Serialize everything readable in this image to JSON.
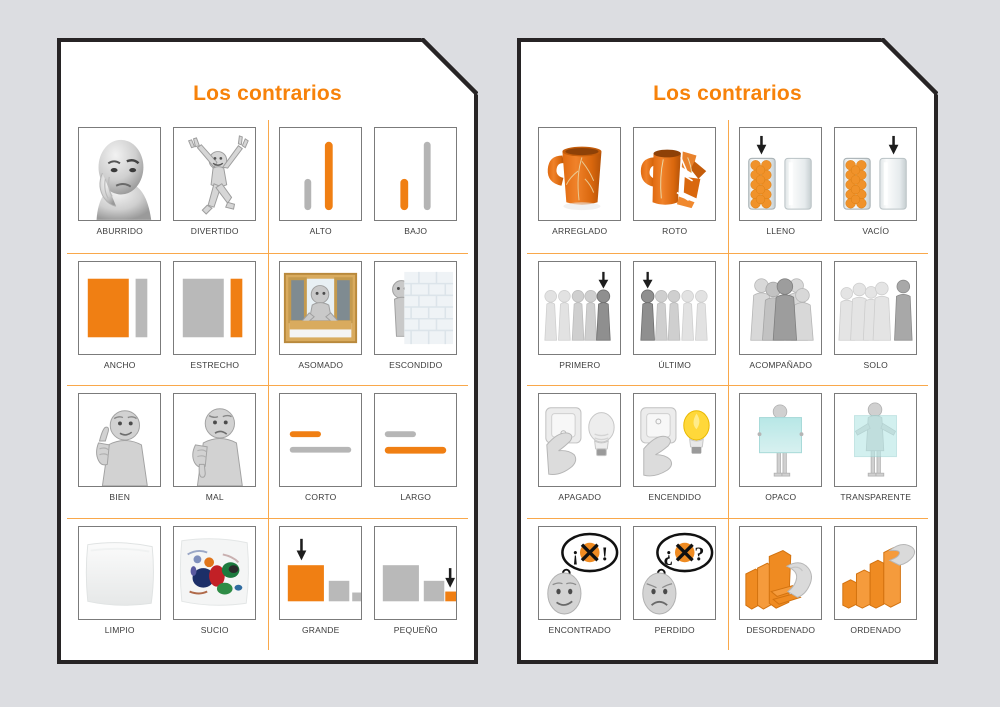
{
  "background_color": "#dcdde1",
  "accent_color": "#F7820A",
  "divider_color": "#F9A84B",
  "page_border_color": "#272425",
  "caption_color": "#3b3b3b",
  "pages": [
    {
      "title": "Los contrarios",
      "rows": [
        {
          "left": [
            {
              "label": "ABURRIDO",
              "icon": "bored-face-icon"
            },
            {
              "label": "DIVERTIDO",
              "icon": "jumping-figure-icon"
            }
          ],
          "right": [
            {
              "label": "ALTO",
              "icon": "tall-bar-icon"
            },
            {
              "label": "BAJO",
              "icon": "short-bar-icon"
            }
          ]
        },
        {
          "left": [
            {
              "label": "ANCHO",
              "icon": "wide-rectangle-icon"
            },
            {
              "label": "ESTRECHO",
              "icon": "narrow-rectangle-icon"
            }
          ],
          "right": [
            {
              "label": "ASOMADO",
              "icon": "figure-at-window-icon"
            },
            {
              "label": "ESCONDIDO",
              "icon": "figure-behind-wall-icon"
            }
          ]
        },
        {
          "left": [
            {
              "label": "BIEN",
              "icon": "thumbs-up-icon"
            },
            {
              "label": "MAL",
              "icon": "thumbs-down-icon"
            }
          ],
          "right": [
            {
              "label": "CORTO",
              "icon": "short-line-icon"
            },
            {
              "label": "LARGO",
              "icon": "long-line-icon"
            }
          ]
        },
        {
          "left": [
            {
              "label": "LIMPIO",
              "icon": "clean-cloth-icon"
            },
            {
              "label": "SUCIO",
              "icon": "dirty-cloth-icon"
            }
          ],
          "right": [
            {
              "label": "GRANDE",
              "icon": "big-square-icon"
            },
            {
              "label": "PEQUEÑO",
              "icon": "small-square-icon"
            }
          ]
        }
      ]
    },
    {
      "title": "Los contrarios",
      "rows": [
        {
          "left": [
            {
              "label": "ARREGLADO",
              "icon": "whole-mug-icon"
            },
            {
              "label": "ROTO",
              "icon": "broken-mug-icon"
            }
          ],
          "right": [
            {
              "label": "LLENO",
              "icon": "full-glass-icon"
            },
            {
              "label": "VACÍO",
              "icon": "empty-glass-icon"
            }
          ]
        },
        {
          "left": [
            {
              "label": "PRIMERO",
              "icon": "first-in-line-icon"
            },
            {
              "label": "ÚLTIMO",
              "icon": "last-in-line-icon"
            }
          ],
          "right": [
            {
              "label": "ACOMPAÑADO",
              "icon": "group-of-figures-icon"
            },
            {
              "label": "SOLO",
              "icon": "lone-figure-icon"
            }
          ]
        },
        {
          "left": [
            {
              "label": "APAGADO",
              "icon": "light-off-switch-icon"
            },
            {
              "label": "ENCENDIDO",
              "icon": "light-on-switch-icon"
            }
          ],
          "right": [
            {
              "label": "OPACO",
              "icon": "opaque-panel-icon"
            },
            {
              "label": "TRANSPARENTE",
              "icon": "transparent-panel-icon"
            }
          ]
        },
        {
          "left": [
            {
              "label": "ENCONTRADO",
              "icon": "found-thought-bubble-icon"
            },
            {
              "label": "PERDIDO",
              "icon": "lost-thought-bubble-icon"
            }
          ],
          "right": [
            {
              "label": "DESORDENADO",
              "icon": "messy-books-icon"
            },
            {
              "label": "ORDENADO",
              "icon": "tidy-books-icon"
            }
          ]
        }
      ]
    }
  ]
}
